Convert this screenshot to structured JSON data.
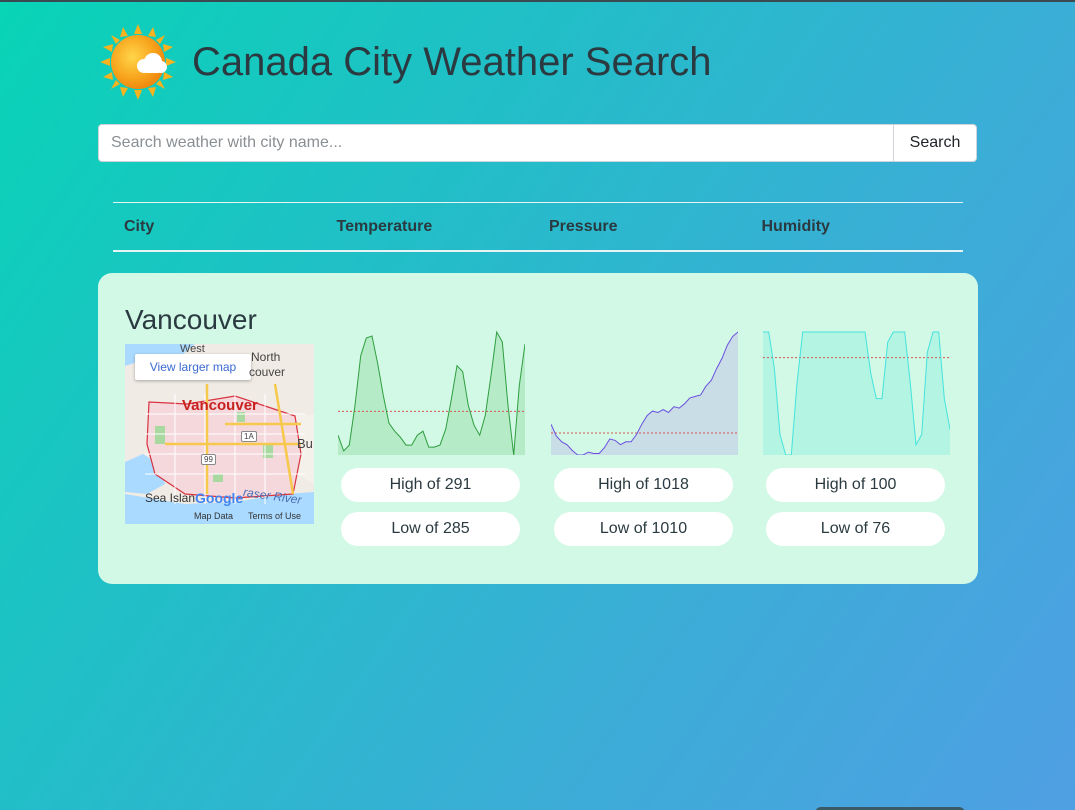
{
  "header": {
    "title": "Canada City Weather Search",
    "logo_icon": "sun-cloud-icon"
  },
  "search": {
    "placeholder": "Search weather with city name...",
    "button_label": "Search"
  },
  "table": {
    "columns": [
      "City",
      "Temperature",
      "Pressure",
      "Humidity"
    ]
  },
  "result": {
    "city": "Vancouver",
    "map": {
      "button_label": "View larger map",
      "labels": {
        "west": "West",
        "north": "North",
        "couver": "couver",
        "city": "Vancouver",
        "bu": "Bu",
        "sea": "Sea Islan",
        "river": "raser River",
        "google": "Google",
        "map_data": "Map Data",
        "terms": "Terms of Use",
        "hw1a": "1A",
        "hw99": "99"
      }
    },
    "temperature": {
      "high_label": "High of 291",
      "low_label": "Low of 285",
      "color": "#2e9e3e",
      "fill": "#b6ebc8"
    },
    "pressure": {
      "high_label": "High of 1018",
      "low_label": "Low of 1010",
      "color": "#6a4fe0",
      "fill": "#c8dde6"
    },
    "humidity": {
      "high_label": "High of 100",
      "low_label": "Low of 76",
      "color": "#44e3dd",
      "fill": "#b3f5e2"
    }
  },
  "chart_data": [
    {
      "type": "area",
      "name": "temperature",
      "values": [
        286.0,
        285.2,
        285.5,
        287.5,
        290.0,
        290.9,
        291.0,
        289.6,
        288.0,
        286.6,
        286.2,
        285.9,
        285.5,
        285.5,
        286.0,
        286.2,
        285.4,
        285.4,
        285.5,
        286.3,
        287.8,
        289.5,
        289.2,
        287.5,
        286.5,
        286.0,
        287.0,
        289.0,
        291.2,
        290.7,
        287.5,
        285.0,
        288.5,
        290.6
      ],
      "ylim": [
        285,
        291.2
      ],
      "reference_line": 287.2
    },
    {
      "type": "area",
      "name": "pressure",
      "values": [
        1012.0,
        1011.2,
        1010.8,
        1010.6,
        1010.2,
        1009.9,
        1009.9,
        1010.1,
        1010.0,
        1010.0,
        1010.4,
        1011.0,
        1010.9,
        1010.6,
        1010.8,
        1010.8,
        1011.3,
        1012.0,
        1012.6,
        1012.9,
        1012.8,
        1013.0,
        1012.8,
        1013.2,
        1013.1,
        1013.4,
        1013.8,
        1013.9,
        1014.0,
        1014.6,
        1015.0,
        1015.8,
        1016.5,
        1017.4,
        1018.0,
        1018.3
      ],
      "ylim": [
        1009.9,
        1018.3
      ],
      "reference_line": 1011.4
    },
    {
      "type": "area",
      "name": "humidity",
      "values": [
        100,
        100,
        93,
        80,
        76,
        76,
        90,
        100,
        100,
        100,
        100,
        100,
        100,
        100,
        100,
        100,
        100,
        100,
        100,
        92,
        87,
        87,
        98,
        100,
        100,
        100,
        90,
        78,
        80,
        96,
        100,
        100,
        87,
        81
      ],
      "ylim": [
        76,
        100
      ],
      "reference_line": 95
    }
  ]
}
